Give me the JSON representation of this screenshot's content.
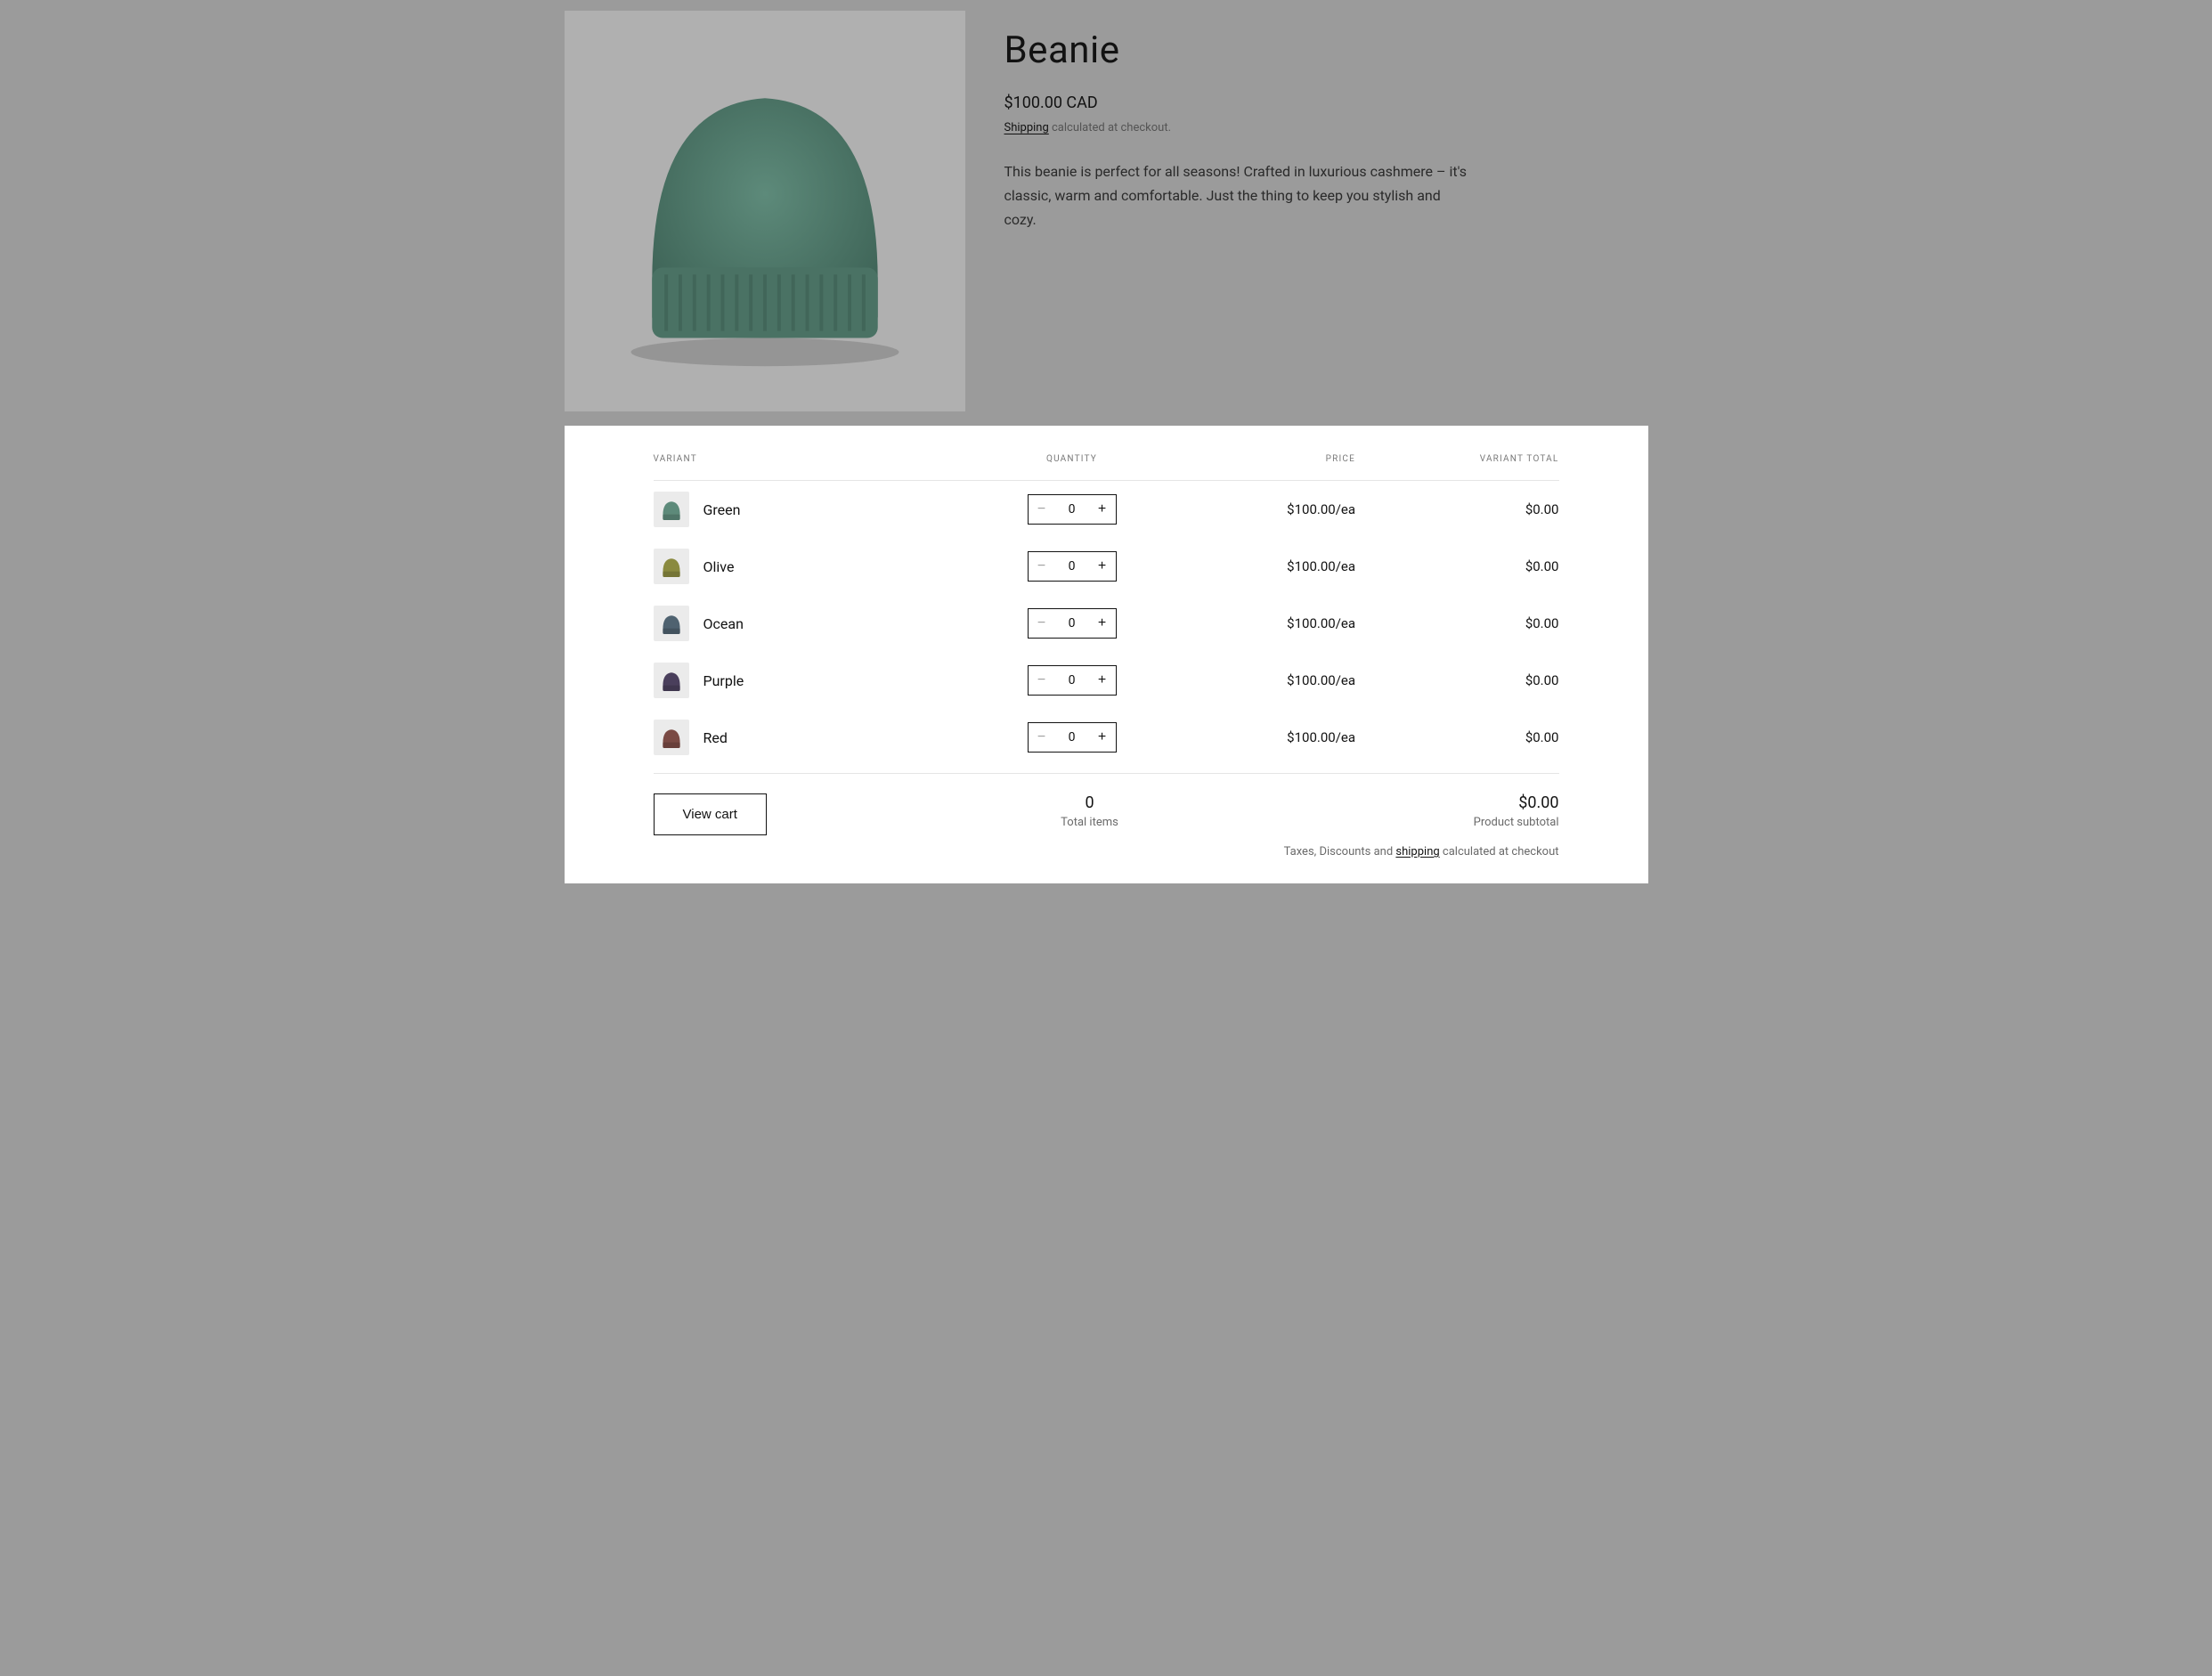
{
  "product": {
    "title": "Beanie",
    "price": "$100.00 CAD",
    "shipping_link_text": "Shipping",
    "shipping_suffix": " calculated at checkout.",
    "description": "This beanie is perfect for all seasons! Crafted in luxurious cashmere – it's classic, warm and comfortable. Just the thing to keep you stylish and cozy.",
    "image_color": "#5d8a7a"
  },
  "table": {
    "headers": {
      "variant": "VARIANT",
      "quantity": "QUANTITY",
      "price": "PRICE",
      "variant_total": "VARIANT TOTAL"
    },
    "variants": [
      {
        "name": "Green",
        "color": "#5d8a7a",
        "qty": "0",
        "price": "$100.00/ea",
        "total": "$0.00"
      },
      {
        "name": "Olive",
        "color": "#8a8a3f",
        "qty": "0",
        "price": "$100.00/ea",
        "total": "$0.00"
      },
      {
        "name": "Ocean",
        "color": "#4f6270",
        "qty": "0",
        "price": "$100.00/ea",
        "total": "$0.00"
      },
      {
        "name": "Purple",
        "color": "#4a3f5c",
        "qty": "0",
        "price": "$100.00/ea",
        "total": "$0.00"
      },
      {
        "name": "Red",
        "color": "#7a4a44",
        "qty": "0",
        "price": "$100.00/ea",
        "total": "$0.00"
      }
    ]
  },
  "footer": {
    "view_cart": "View cart",
    "total_items_value": "0",
    "total_items_label": "Total items",
    "subtotal_value": "$0.00",
    "subtotal_label": "Product subtotal",
    "tax_prefix": "Taxes, Discounts and ",
    "tax_link": "shipping",
    "tax_suffix": " calculated at checkout"
  }
}
